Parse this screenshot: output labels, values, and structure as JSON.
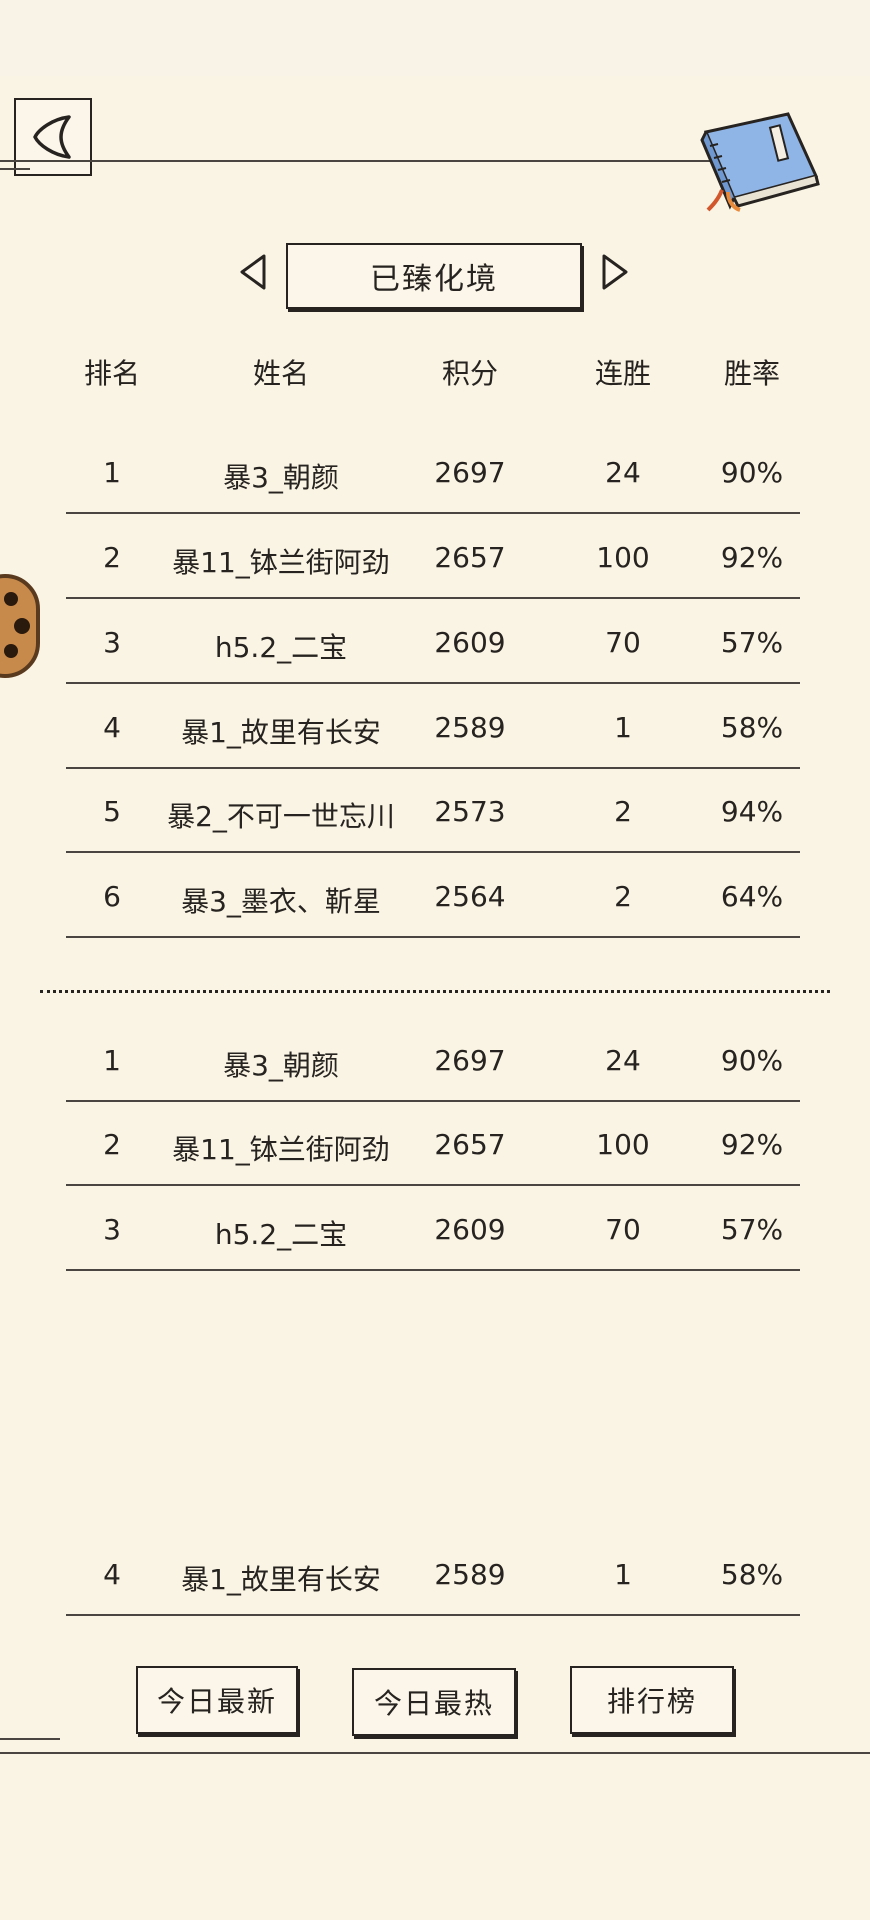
{
  "category": {
    "current": "已臻化境"
  },
  "table": {
    "headers": {
      "rank": "排名",
      "name": "姓名",
      "score": "积分",
      "streak": "连胜",
      "rate": "胜率"
    },
    "top_rows": [
      {
        "rank": "1",
        "name": "暴3_朝颜",
        "score": "2697",
        "streak": "24",
        "rate": "90%"
      },
      {
        "rank": "2",
        "name": "暴11_钵兰街阿劲",
        "score": "2657",
        "streak": "100",
        "rate": "92%"
      },
      {
        "rank": "3",
        "name": "h5.2_二宝",
        "score": "2609",
        "streak": "70",
        "rate": "57%"
      },
      {
        "rank": "4",
        "name": "暴1_故里有长安",
        "score": "2589",
        "streak": "1",
        "rate": "58%"
      },
      {
        "rank": "5",
        "name": "暴2_不可一世忘川",
        "score": "2573",
        "streak": "2",
        "rate": "94%"
      },
      {
        "rank": "6",
        "name": "暴3_墨衣、靳星",
        "score": "2564",
        "streak": "2",
        "rate": "64%"
      }
    ],
    "bottom_rows": [
      {
        "rank": "1",
        "name": "暴3_朝颜",
        "score": "2697",
        "streak": "24",
        "rate": "90%"
      },
      {
        "rank": "2",
        "name": "暴11_钵兰街阿劲",
        "score": "2657",
        "streak": "100",
        "rate": "92%"
      },
      {
        "rank": "3",
        "name": "h5.2_二宝",
        "score": "2609",
        "streak": "70",
        "rate": "57%"
      },
      {
        "rank": "4",
        "name": "暴1_故里有长安",
        "score": "2589",
        "streak": "1",
        "rate": "58%"
      }
    ]
  },
  "footer": {
    "today_newest": "今日最新",
    "today_hottest": "今日最热",
    "leaderboard": "排行榜"
  },
  "icons": {
    "back": "back-chevron-icon",
    "book": "book-icon",
    "prev": "triangle-left-icon",
    "next": "triangle-right-icon",
    "avatar": "avatar-icon"
  },
  "colors": {
    "background": "#faf4e4",
    "ink": "#262320",
    "book_blue": "#8fb4e6"
  }
}
